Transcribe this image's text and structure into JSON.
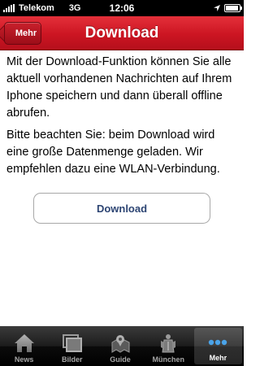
{
  "status_bar": {
    "carrier": "Telekom",
    "network": "3G",
    "time": "12:06"
  },
  "nav": {
    "back_label": "Mehr",
    "title": "Download"
  },
  "content": {
    "paragraph_1": "Mit der Download-Funktion können Sie alle aktuell vorhandenen Nachrichten auf Ihrem Iphone speichern und dann überall offline abrufen.",
    "paragraph_2": "Bitte beachten Sie: beim Download wird eine große Datenmenge geladen. Wir empfehlen dazu eine WLAN-Verbindung.",
    "download_button_label": "Download"
  },
  "tab_bar": {
    "tabs": [
      {
        "label": "News",
        "icon": "house-icon",
        "active": false
      },
      {
        "label": "Bilder",
        "icon": "pictures-icon",
        "active": false
      },
      {
        "label": "Guide",
        "icon": "map-pin-icon",
        "active": false
      },
      {
        "label": "München",
        "icon": "munich-emblem-icon",
        "active": false
      },
      {
        "label": "Mehr",
        "icon": "more-dots-icon",
        "active": true
      }
    ]
  },
  "colors": {
    "nav_red": "#cc1522",
    "button_text": "#2d4573",
    "active_tab_dots": "#4aa3e8"
  }
}
